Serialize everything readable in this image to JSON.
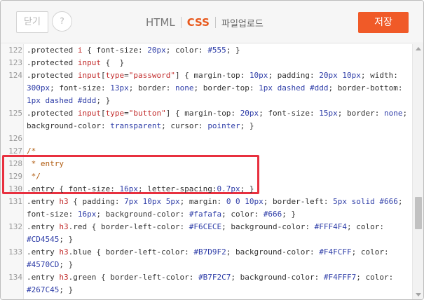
{
  "header": {
    "close_label": "닫기",
    "help_label": "?",
    "tabs": [
      "HTML",
      "CSS",
      "파일업로드"
    ],
    "active_tab": "CSS",
    "save_label": "저장"
  },
  "colors": {
    "accent": "#f05a28",
    "active_tab": "#e8591d",
    "highlight_box": "#e8303f",
    "value_blue": "#2f3ea8",
    "string_red": "#c22b2b",
    "comment": "#b05c10"
  },
  "lines": [
    {
      "n": "122",
      "segs": [
        {
          "t": ".protected ",
          "c": "sel"
        },
        {
          "t": "i",
          "c": "str"
        },
        {
          "t": " { font-size: ",
          "c": "sel"
        },
        {
          "t": "20px",
          "c": "num"
        },
        {
          "t": "; color: ",
          "c": "sel"
        },
        {
          "t": "#555",
          "c": "val"
        },
        {
          "t": "; }",
          "c": "sel"
        }
      ]
    },
    {
      "n": "123",
      "segs": [
        {
          "t": ".protected ",
          "c": "sel"
        },
        {
          "t": "input",
          "c": "str"
        },
        {
          "t": " {  }",
          "c": "sel"
        }
      ]
    },
    {
      "n": "124",
      "segs": [
        {
          "t": ".protected ",
          "c": "sel"
        },
        {
          "t": "input",
          "c": "str"
        },
        {
          "t": "[",
          "c": "sel"
        },
        {
          "t": "type",
          "c": "str"
        },
        {
          "t": "=",
          "c": "sel"
        },
        {
          "t": "\"password\"",
          "c": "str"
        },
        {
          "t": "] { margin-top: ",
          "c": "sel"
        },
        {
          "t": "10px",
          "c": "num"
        },
        {
          "t": "; padding: ",
          "c": "sel"
        },
        {
          "t": "20px 10px",
          "c": "num"
        },
        {
          "t": "; width:",
          "c": "sel"
        }
      ]
    },
    {
      "n": "",
      "segs": [
        {
          "t": "300px",
          "c": "num"
        },
        {
          "t": "; font-size: ",
          "c": "sel"
        },
        {
          "t": "13px",
          "c": "num"
        },
        {
          "t": "; border: ",
          "c": "sel"
        },
        {
          "t": "none",
          "c": "val"
        },
        {
          "t": "; border-top: ",
          "c": "sel"
        },
        {
          "t": "1px dashed #ddd",
          "c": "val"
        },
        {
          "t": "; border-bottom:",
          "c": "sel"
        }
      ]
    },
    {
      "n": "",
      "segs": [
        {
          "t": "1px dashed #ddd",
          "c": "val"
        },
        {
          "t": "; }",
          "c": "sel"
        }
      ]
    },
    {
      "n": "125",
      "segs": [
        {
          "t": ".protected ",
          "c": "sel"
        },
        {
          "t": "input",
          "c": "str"
        },
        {
          "t": "[",
          "c": "sel"
        },
        {
          "t": "type",
          "c": "str"
        },
        {
          "t": "=",
          "c": "sel"
        },
        {
          "t": "\"button\"",
          "c": "str"
        },
        {
          "t": "] { margin-top: ",
          "c": "sel"
        },
        {
          "t": "20px",
          "c": "num"
        },
        {
          "t": "; font-size: ",
          "c": "sel"
        },
        {
          "t": "15px",
          "c": "num"
        },
        {
          "t": "; border: ",
          "c": "sel"
        },
        {
          "t": "none",
          "c": "val"
        },
        {
          "t": ";",
          "c": "sel"
        }
      ]
    },
    {
      "n": "",
      "segs": [
        {
          "t": "background-color: ",
          "c": "sel"
        },
        {
          "t": "transparent",
          "c": "val"
        },
        {
          "t": "; cursor: ",
          "c": "sel"
        },
        {
          "t": "pointer",
          "c": "val"
        },
        {
          "t": "; }",
          "c": "sel"
        }
      ]
    },
    {
      "n": "126",
      "segs": []
    },
    {
      "n": "127",
      "segs": [
        {
          "t": "/*",
          "c": "com"
        }
      ]
    },
    {
      "n": "128",
      "segs": [
        {
          "t": " * entry",
          "c": "com"
        }
      ]
    },
    {
      "n": "129",
      "segs": [
        {
          "t": " */",
          "c": "com"
        }
      ]
    },
    {
      "n": "130",
      "segs": [
        {
          "t": ".entry { font-size: ",
          "c": "sel"
        },
        {
          "t": "16px",
          "c": "num"
        },
        {
          "t": "; letter-spacing:",
          "c": "sel"
        },
        {
          "t": "0.7px",
          "c": "num"
        },
        {
          "t": "; }",
          "c": "sel"
        }
      ]
    },
    {
      "n": "131",
      "segs": [
        {
          "t": ".entry ",
          "c": "sel"
        },
        {
          "t": "h3",
          "c": "str"
        },
        {
          "t": " { padding: ",
          "c": "sel"
        },
        {
          "t": "7px 10px 5px",
          "c": "num"
        },
        {
          "t": "; margin: ",
          "c": "sel"
        },
        {
          "t": "0 0 10px",
          "c": "num"
        },
        {
          "t": "; border-left: ",
          "c": "sel"
        },
        {
          "t": "5px solid #666",
          "c": "val"
        },
        {
          "t": ";",
          "c": "sel"
        }
      ]
    },
    {
      "n": "",
      "segs": [
        {
          "t": "font-size: ",
          "c": "sel"
        },
        {
          "t": "16px",
          "c": "num"
        },
        {
          "t": "; background-color: ",
          "c": "sel"
        },
        {
          "t": "#fafafa",
          "c": "val"
        },
        {
          "t": "; color: ",
          "c": "sel"
        },
        {
          "t": "#666",
          "c": "val"
        },
        {
          "t": "; }",
          "c": "sel"
        }
      ]
    },
    {
      "n": "132",
      "segs": [
        {
          "t": ".entry ",
          "c": "sel"
        },
        {
          "t": "h3",
          "c": "str"
        },
        {
          "t": ".red { border-left-color: ",
          "c": "sel"
        },
        {
          "t": "#F6CECE",
          "c": "val"
        },
        {
          "t": "; background-color: ",
          "c": "sel"
        },
        {
          "t": "#FFF4F4",
          "c": "val"
        },
        {
          "t": "; color:",
          "c": "sel"
        }
      ]
    },
    {
      "n": "",
      "segs": [
        {
          "t": "#CD4545",
          "c": "val"
        },
        {
          "t": "; }",
          "c": "sel"
        }
      ]
    },
    {
      "n": "133",
      "segs": [
        {
          "t": ".entry ",
          "c": "sel"
        },
        {
          "t": "h3",
          "c": "str"
        },
        {
          "t": ".blue { border-left-color: ",
          "c": "sel"
        },
        {
          "t": "#B7D9F2",
          "c": "val"
        },
        {
          "t": "; background-color: ",
          "c": "sel"
        },
        {
          "t": "#F4FCFF",
          "c": "val"
        },
        {
          "t": "; color:",
          "c": "sel"
        }
      ]
    },
    {
      "n": "",
      "segs": [
        {
          "t": "#4570CD",
          "c": "val"
        },
        {
          "t": "; }",
          "c": "sel"
        }
      ]
    },
    {
      "n": "134",
      "segs": [
        {
          "t": ".entry ",
          "c": "sel"
        },
        {
          "t": "h3",
          "c": "str"
        },
        {
          "t": ".green { border-left-color: ",
          "c": "sel"
        },
        {
          "t": "#B7F2C7",
          "c": "val"
        },
        {
          "t": "; background-color: ",
          "c": "sel"
        },
        {
          "t": "#F4FFF7",
          "c": "val"
        },
        {
          "t": "; color:",
          "c": "sel"
        }
      ]
    },
    {
      "n": "",
      "segs": [
        {
          "t": "#267C45",
          "c": "val"
        },
        {
          "t": "; }",
          "c": "sel"
        }
      ]
    }
  ]
}
